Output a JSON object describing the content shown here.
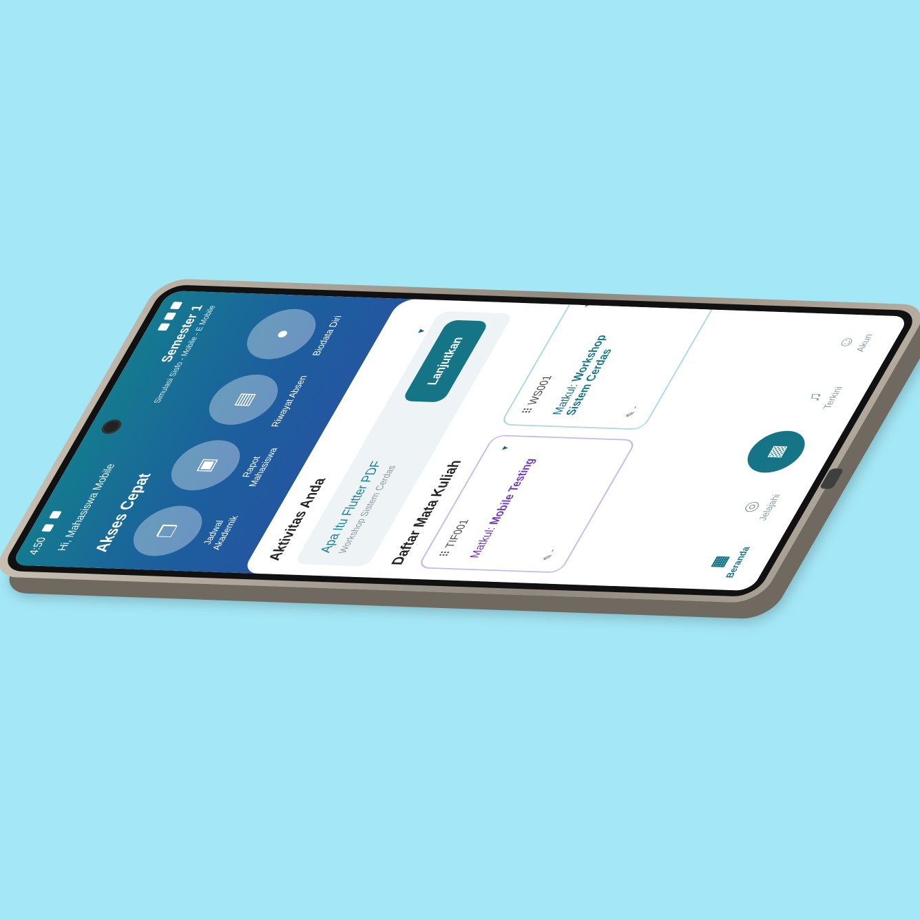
{
  "status": {
    "time": "4:50"
  },
  "header": {
    "greeting": "Hi, Mahasiswa Mobile",
    "semester": "Semester 1",
    "subtitle": "Simulasi Sisfo - Mobile - E Mobile",
    "quick_title": "Akses Cepat"
  },
  "quick_access": [
    {
      "label": "Jadwal Akademik",
      "icon": "bookmark-icon"
    },
    {
      "label": "Rapot Mahasiswa",
      "icon": "book-icon"
    },
    {
      "label": "Riwayat Absen",
      "icon": "chart-icon"
    },
    {
      "label": "Biodata Diri",
      "icon": "user-icon"
    }
  ],
  "activity": {
    "title": "Aktivitas Anda",
    "item_title": "Apa Itu Flutter PDF",
    "item_sub": "Workshop Sistem Cerdas",
    "button": "Lanjutkan"
  },
  "courses": {
    "title": "Daftar Mata Kuliah",
    "items": [
      {
        "code": "TIF001",
        "prefix": "Matkul:",
        "name": "Mobile Testing",
        "foot": "-"
      },
      {
        "code": "WS001",
        "prefix": "Matkul:",
        "name": "Workshop Sistem Cerdas",
        "foot": "-"
      }
    ]
  },
  "nav": {
    "home": "Beranda",
    "explore": "Jelajahi",
    "news": "Terkini",
    "account": "Akun"
  },
  "colors": {
    "primary": "#157486",
    "accent_purple": "#6e36c9",
    "background": "#a4e8f7"
  }
}
